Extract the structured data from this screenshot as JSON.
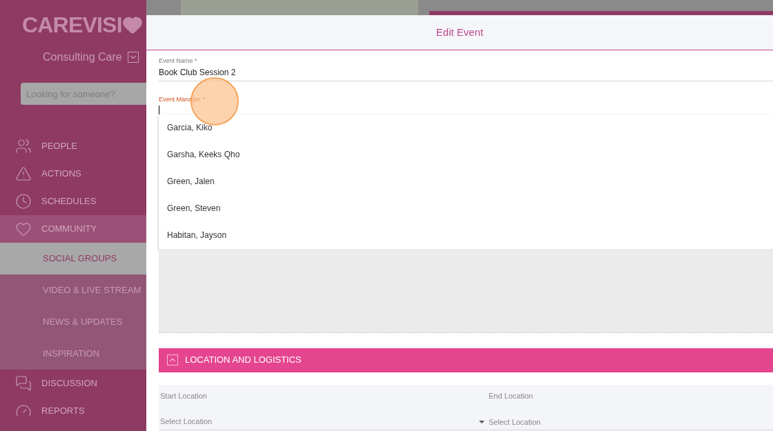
{
  "sidebar": {
    "logo": "CAREVISI",
    "org": "Consulting Care",
    "search": {
      "placeholder": "Looking for someone?"
    },
    "items": [
      {
        "label": "PEOPLE",
        "expanded": false
      },
      {
        "label": "ACTIONS",
        "expanded": false
      },
      {
        "label": "SCHEDULES",
        "expanded": false
      },
      {
        "label": "COMMUNITY",
        "expanded": true,
        "children": [
          {
            "label": "SOCIAL GROUPS",
            "selected": true
          },
          {
            "label": "VIDEO & LIVE STREAM",
            "selected": false
          },
          {
            "label": "NEWS & UPDATES",
            "selected": false
          },
          {
            "label": "INSPIRATION",
            "selected": false
          }
        ]
      },
      {
        "label": "DISCUSSION",
        "expanded": false
      },
      {
        "label": "REPORTS",
        "expanded": false
      }
    ]
  },
  "modal": {
    "title": "Edit Event",
    "event_name": {
      "label": "Event Name *",
      "value": "Book Club Session 2"
    },
    "event_manager": {
      "label": "Event Manager *",
      "focused": true
    },
    "options": [
      "Garcia, Kiko",
      "Garsha, Keeks Qho",
      "Green, Jalen",
      "Green, Steven",
      "Habitan, Jayson"
    ],
    "section": {
      "title": "LOCATION AND LOGISTICS",
      "expanded": true
    },
    "start_location": {
      "label": "Start Location",
      "placeholder": "Select Location"
    },
    "end_location": {
      "label": "End Location",
      "placeholder": "Select Location"
    }
  }
}
